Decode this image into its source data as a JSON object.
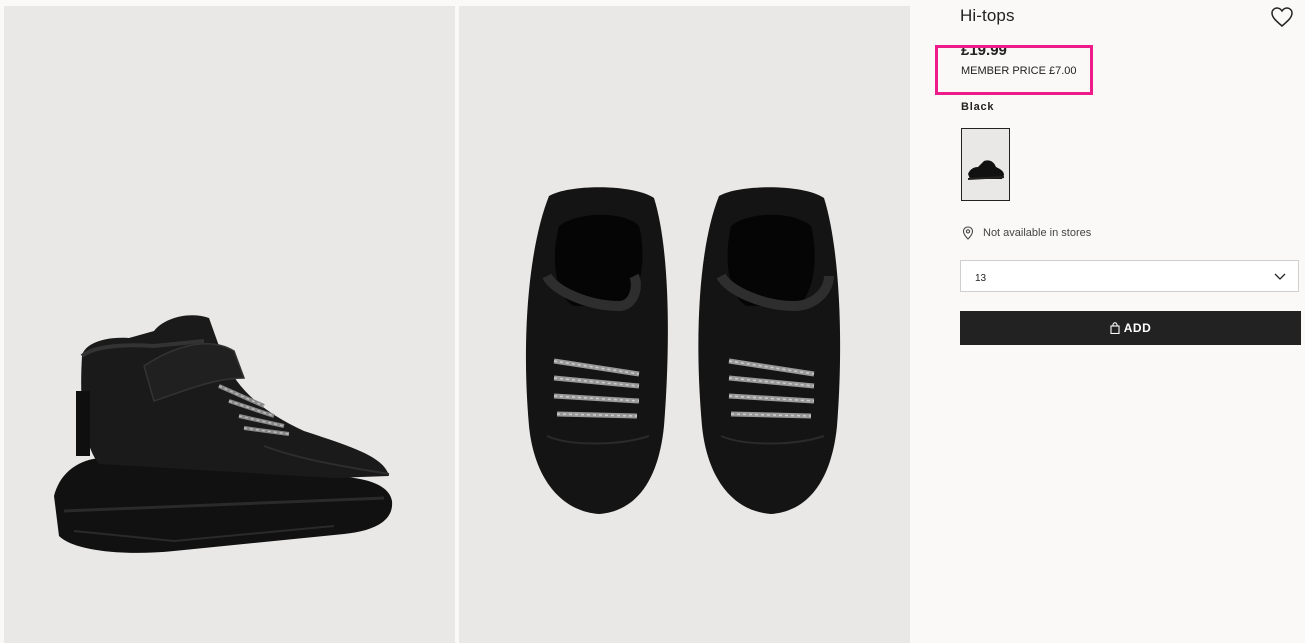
{
  "product": {
    "title": "Hi-tops",
    "price": "£19.99",
    "member_price": "MEMBER PRICE £7.00",
    "color_label": "Black",
    "availability": "Not available in stores",
    "size_selected": "13",
    "add_label": "ADD"
  },
  "icons": {
    "favorite": "heart-icon",
    "location": "location-pin-icon",
    "dropdown": "chevron-down-icon",
    "bag": "shopping-bag-icon"
  },
  "colors": {
    "highlight": "#ee1c8a",
    "button_bg": "#222222",
    "image_bg": "#e9e8e6"
  }
}
